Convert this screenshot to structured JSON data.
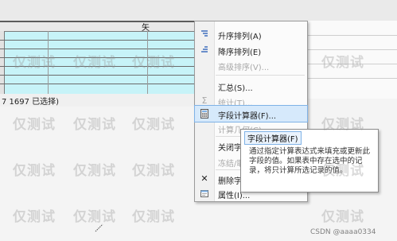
{
  "grid": {
    "column_header": "矢"
  },
  "status_bar": {
    "text": "7 1697 已选择)"
  },
  "context_menu": {
    "items": [
      {
        "label": "升序排列(A)",
        "icon": "sort-ascending-icon",
        "enabled": true
      },
      {
        "label": "降序排列(E)",
        "icon": "sort-descending-icon",
        "enabled": true
      },
      {
        "label": "高级排序(V)...",
        "icon": "",
        "enabled": false
      },
      {
        "label": "汇总(S)...",
        "icon": "",
        "enabled": true
      },
      {
        "label": "统计(T)...",
        "icon": "sigma-icon",
        "enabled": false
      },
      {
        "label": "字段计算器(F)...",
        "icon": "calculator-icon",
        "enabled": true,
        "highlighted": true
      },
      {
        "label": "计算几何(C)...",
        "icon": "",
        "enabled": false
      },
      {
        "label": "关闭字段",
        "icon": "",
        "enabled": true
      },
      {
        "label": "冻结/取消冻结列",
        "icon": "",
        "enabled": false
      },
      {
        "label": "删除字段",
        "icon": "delete-icon",
        "enabled": true
      },
      {
        "label": "属性(I)...",
        "icon": "properties-icon",
        "enabled": true
      }
    ]
  },
  "tooltip": {
    "title": "字段计算器(F)",
    "body": "通过指定计算表达式来填充或更新此字段的值。如果表中存在选中的记录，将只计算所选记录的值。"
  },
  "watermark": {
    "text": "仅测试"
  },
  "credit": {
    "text": "CSDN @aaaa0334"
  },
  "colors": {
    "grid_bg": "#c7f3f8",
    "menu_highlight": "#d6e9fb",
    "menu_icon": "#3d6ebd"
  }
}
